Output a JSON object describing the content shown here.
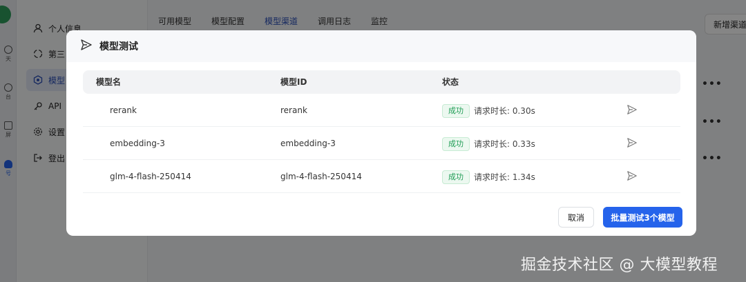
{
  "rail": {
    "items": [
      {
        "label": "天"
      },
      {
        "label": "台"
      },
      {
        "label": "屏"
      },
      {
        "label": "号"
      }
    ]
  },
  "sidebar": {
    "items": [
      {
        "label": "个人信息"
      },
      {
        "label": "第三"
      },
      {
        "label": "模型"
      },
      {
        "label": "API"
      },
      {
        "label": "设置"
      },
      {
        "label": "登出"
      }
    ]
  },
  "tabs": [
    {
      "label": "可用模型"
    },
    {
      "label": "模型配置"
    },
    {
      "label": "模型渠道"
    },
    {
      "label": "调用日志"
    },
    {
      "label": "监控"
    }
  ],
  "header_button": "新增渠道",
  "more_label": "•••",
  "modal": {
    "title": "模型测试",
    "columns": [
      "模型名",
      "模型ID",
      "状态"
    ],
    "rows": [
      {
        "name": "rerank",
        "id": "rerank",
        "status": "成功",
        "duration": "请求时长: 0.30s"
      },
      {
        "name": "embedding-3",
        "id": "embedding-3",
        "status": "成功",
        "duration": "请求时长: 0.33s"
      },
      {
        "name": "glm-4-flash-250414",
        "id": "glm-4-flash-250414",
        "status": "成功",
        "duration": "请求时长: 1.34s"
      }
    ],
    "cancel_label": "取消",
    "batch_label": "批量测试3个模型"
  },
  "watermark": "掘金技术社区 @ 大模型教程",
  "colors": {
    "primary": "#2563eb",
    "success": "#1f9d55",
    "logo": "#2f9e5c"
  },
  "icons": [
    "send-icon",
    "user-icon",
    "spinner-icon",
    "model-icon",
    "key-icon",
    "gear-icon",
    "logout-icon"
  ]
}
